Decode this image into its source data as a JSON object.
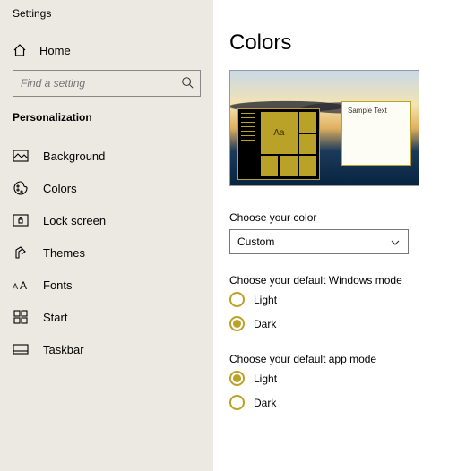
{
  "app_title": "Settings",
  "home_label": "Home",
  "search": {
    "placeholder": "Find a setting"
  },
  "section_label": "Personalization",
  "nav": [
    {
      "label": "Background"
    },
    {
      "label": "Colors"
    },
    {
      "label": "Lock screen"
    },
    {
      "label": "Themes"
    },
    {
      "label": "Fonts"
    },
    {
      "label": "Start"
    },
    {
      "label": "Taskbar"
    }
  ],
  "page_title": "Colors",
  "preview": {
    "window_title": "Sample Text",
    "tile_text": "Aa"
  },
  "color_choice": {
    "label": "Choose your color",
    "value": "Custom"
  },
  "windows_mode": {
    "label": "Choose your default Windows mode",
    "options": [
      "Light",
      "Dark"
    ],
    "selected": "Dark"
  },
  "app_mode": {
    "label": "Choose your default app mode",
    "options": [
      "Light",
      "Dark"
    ],
    "selected": "Light"
  },
  "accent_color": "#b9a227"
}
